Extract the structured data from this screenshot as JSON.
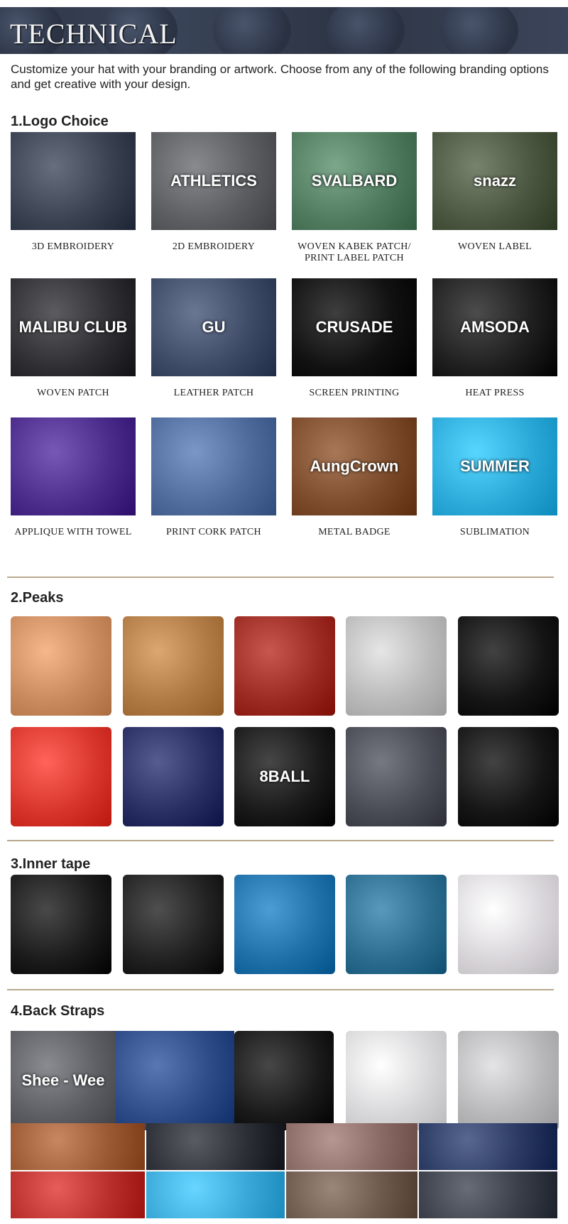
{
  "header": {
    "title": "TECHNICAL"
  },
  "intro": {
    "text": "Customize your hat with your branding or artwork. Choose from any of the following branding options and get creative with your design."
  },
  "logo_choice": {
    "title": "1.Logo Choice",
    "items": [
      {
        "caption": "3D EMBROIDERY",
        "overlay": "",
        "color": "#3a4252"
      },
      {
        "caption": "2D EMBROIDERY",
        "overlay": "ATHLETICS",
        "color": "#5b5d61"
      },
      {
        "caption": "WOVEN KABEK PATCH/ PRINT LABEL PATCH",
        "overlay": "SVALBARD",
        "color": "#4f7a5e"
      },
      {
        "caption": "WOVEN LABEL",
        "overlay": "snazz",
        "color": "#4a5640"
      },
      {
        "caption": "WOVEN PATCH",
        "overlay": "MALIBU CLUB",
        "color": "#2f2f33"
      },
      {
        "caption": "LEATHER PATCH",
        "overlay": "GU",
        "color": "#3d4a66"
      },
      {
        "caption": "SCREEN PRINTING",
        "overlay": "CRUSADE",
        "color": "#111111"
      },
      {
        "caption": "HEAT PRESS",
        "overlay": "AMSODA",
        "color": "#1f1f1f"
      },
      {
        "caption": "APPLIQUE WITH TOWEL",
        "overlay": "",
        "color": "#4a2b8a"
      },
      {
        "caption": "PRINT CORK PATCH",
        "overlay": "",
        "color": "#4d6a9a"
      },
      {
        "caption": "METAL BADGE",
        "overlay": "AungCrown",
        "color": "#7a4a2a"
      },
      {
        "caption": "SUBLIMATION",
        "overlay": "SUMMER",
        "color": "#2aa9d8"
      }
    ]
  },
  "peaks": {
    "title": "2.Peaks",
    "items": [
      {
        "color": "#c98a5e",
        "overlay": ""
      },
      {
        "color": "#b07a45",
        "overlay": ""
      },
      {
        "color": "#9b2a22",
        "overlay": ""
      },
      {
        "color": "#b9b9b9",
        "overlay": ""
      },
      {
        "color": "#151515",
        "overlay": ""
      },
      {
        "color": "#d8362c",
        "overlay": ""
      },
      {
        "color": "#2a2f63",
        "overlay": ""
      },
      {
        "color": "#1a1a1a",
        "overlay": "8BALL"
      },
      {
        "color": "#4a4c55",
        "overlay": ""
      },
      {
        "color": "#161616",
        "overlay": ""
      }
    ]
  },
  "inner_tape": {
    "title": "3.Inner tape",
    "items": [
      {
        "color": "#1c1c1c"
      },
      {
        "color": "#222222"
      },
      {
        "color": "#1f6fa8"
      },
      {
        "color": "#2c6d8f"
      },
      {
        "color": "#d9d6da"
      }
    ]
  },
  "back_straps": {
    "title": "4.Back Straps",
    "row1": [
      {
        "color": "#5c5e63",
        "overlay": "Shee - Wee"
      },
      {
        "color": "#2b4a86",
        "overlay": ""
      },
      {
        "color": "#1a1a1a",
        "overlay": ""
      },
      {
        "color": "#d7d7d9",
        "overlay": ""
      },
      {
        "color": "#b7b7b9",
        "overlay": ""
      }
    ],
    "row2": [
      {
        "color": "#9b5a34"
      },
      {
        "color": "#2c2f36"
      },
      {
        "color": "#8a6a64"
      },
      {
        "color": "#2b3a63"
      }
    ],
    "row3": [
      {
        "color": "#b9302c"
      },
      {
        "color": "#3aa9d9"
      },
      {
        "color": "#6e5a4c"
      },
      {
        "color": "#3a3f49"
      }
    ]
  }
}
